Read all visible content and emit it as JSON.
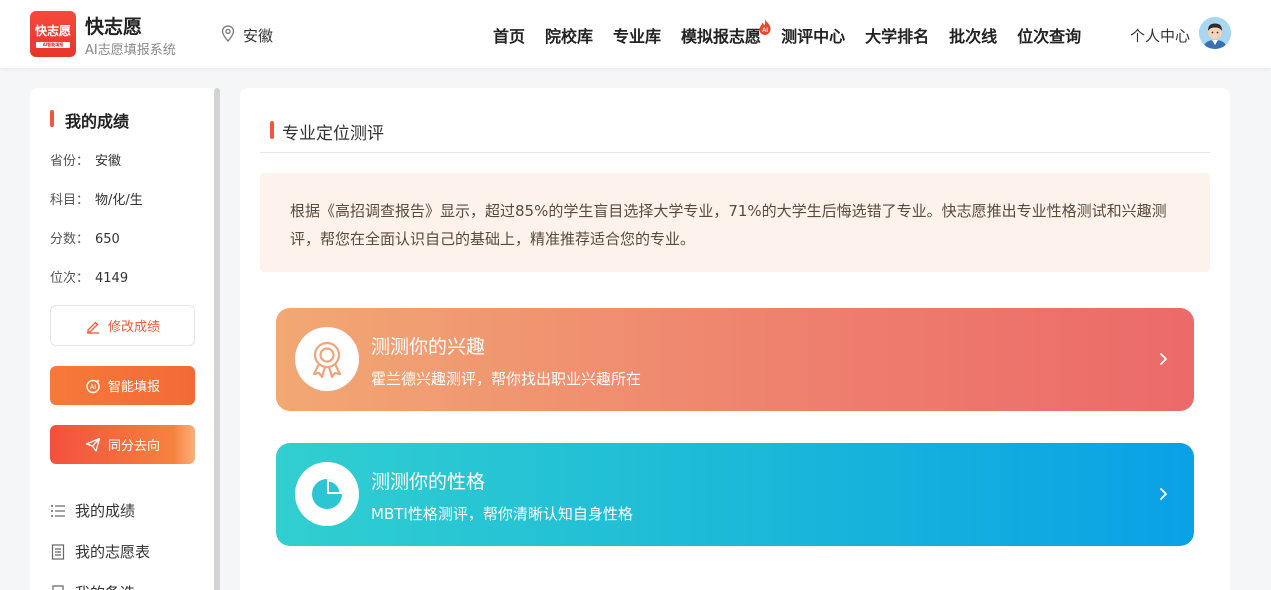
{
  "header": {
    "logo_text": "快志愿",
    "logo_sub": "AI智能填报",
    "brand_name": "快志愿",
    "brand_sub": "AI志愿填报系统",
    "location": "安徽",
    "nav": [
      {
        "label": "首页"
      },
      {
        "label": "院校库"
      },
      {
        "label": "专业库"
      },
      {
        "label": "模拟报志愿",
        "badge": "AI"
      },
      {
        "label": "测评中心"
      },
      {
        "label": "大学排名"
      },
      {
        "label": "批次线"
      },
      {
        "label": "位次查询"
      }
    ],
    "user_label": "个人中心"
  },
  "sidebar": {
    "title": "我的成绩",
    "rows": [
      {
        "label": "省份：",
        "value": "安徽"
      },
      {
        "label": "科目：",
        "value": "物/化/生"
      },
      {
        "label": "分数：",
        "value": "650"
      },
      {
        "label": "位次：",
        "value": "4149"
      }
    ],
    "edit_button": "修改成绩",
    "smart_button": "智能填报",
    "same_score_button": "同分去向",
    "menu": [
      {
        "label": "我的成绩"
      },
      {
        "label": "我的志愿表"
      },
      {
        "label": "我的备选"
      }
    ]
  },
  "main": {
    "title": "专业定位测评",
    "notice": "根据《高招调查报告》显示，超过85%的学生盲目选择大学专业，71%的大学生后悔选错了专业。快志愿推出专业性格测试和兴趣测评，帮您在全面认识自己的基础上，精准推荐适合您的专业。",
    "cards": [
      {
        "title": "测测你的兴趣",
        "desc": "霍兰德兴趣测评，帮你找出职业兴趣所在",
        "icon": "award-icon"
      },
      {
        "title": "测测你的性格",
        "desc": "MBTI性格测评，帮你清晰认知自身性格",
        "icon": "pie-chart-icon"
      }
    ]
  },
  "colors": {
    "accent": "#f5553d",
    "orange_card": "#ee7e6e",
    "blue_card": "#1ab7d9"
  }
}
